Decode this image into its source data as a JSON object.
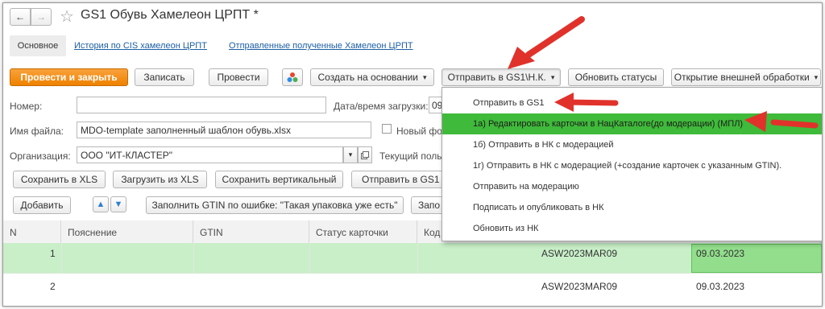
{
  "window": {
    "title": "GS1 Обувь Хамелеон ЦРПТ *",
    "nav_back": "←",
    "nav_forward": "→",
    "star": "☆"
  },
  "tabs": {
    "main": "Основное",
    "history": "История по CIS хамелеон ЦРПТ",
    "sent": "Отправленные полученные Хамелеон ЦРПТ"
  },
  "toolbar": {
    "post_close": "Провести и закрыть",
    "save": "Записать",
    "post": "Провести",
    "create_based": "Создать на основании",
    "send_gs1": "Отправить в GS1\\Н.К.",
    "update_status": "Обновить статусы",
    "open_external": "Открытие внешней обработки",
    "dropdown_caret": "▾"
  },
  "form": {
    "number_label": "Номер:",
    "number_value": "",
    "load_date_label": "Дата/время загрузки:",
    "load_date_value": "09",
    "filename_label": "Имя файла:",
    "filename_value": "MDO-template заполненный шаблон обувь.xlsx",
    "new_format_label": "Новый фор",
    "new_format_checked": false,
    "org_label": "Организация:",
    "org_value": "ООО \"ИТ-КЛАСТЕР\"",
    "current_user_label": "Текущий поль"
  },
  "actions": {
    "save_xls": "Сохранить в XLS",
    "load_xls": "Загрузить из XLS",
    "save_vertical": "Сохранить вертикальный",
    "send_gs1b": "Отправить в GS1 Б"
  },
  "table_toolbar": {
    "add": "Добавить",
    "up_icon": "▲",
    "down_icon": "▼",
    "fill_gtin": "Заполнить GTIN по ошибке: \"Такая упаковка уже есть\"",
    "fill_more": "Запо"
  },
  "table": {
    "headers": [
      "N",
      "Пояснение",
      "GTIN",
      "Статус карточки",
      "Код"
    ],
    "rows": [
      {
        "n": "1",
        "code": "ASW2023MAR09",
        "date": "09.03.2023",
        "selected": true
      },
      {
        "n": "2",
        "code": "ASW2023MAR09",
        "date": "09.03.2023",
        "selected": false
      }
    ]
  },
  "menu": {
    "items": [
      "Отправить в GS1",
      "1а) Редактировать карточки в НацКаталоге(до модерации) (МПЛ)",
      "1б) Отправить в НК с модерацией",
      "1г) Отправить в НК с модерацией (+создание карточек с указанным GTIN).",
      "Отправить на модерацию",
      "Подписать и опубликовать в НК",
      "Обновить из НК"
    ],
    "highlighted_index": 1,
    "highlight_color": "#3fba3a"
  },
  "colors": {
    "primary_button": "#f08a0f",
    "selected_row": "#c9efc9",
    "selected_date_cell": "#92de8c",
    "annotation_arrow": "#e0322b"
  }
}
